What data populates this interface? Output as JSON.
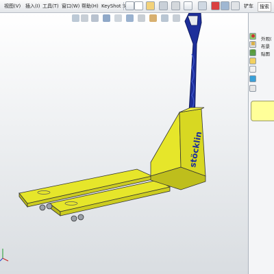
{
  "menubar": {
    "items": [
      "视图(V)",
      "插入(I)",
      "工具(T)",
      "窗口(W)",
      "帮助(H)",
      "KeyShot 5"
    ],
    "right_label": "铲车",
    "search_label": "搜索"
  },
  "model": {
    "brand": "stöcklin",
    "body_color": "#e6e62a",
    "handle_color": "#1e2f9a"
  },
  "taskpane": {
    "collapse_label": "«",
    "tree": [
      "外观(",
      "布景",
      "贴图"
    ]
  },
  "colors": {
    "viewport_top": "#ffffff",
    "viewport_bottom": "#d9dde1",
    "tooltip_bg": "#ffff99"
  }
}
